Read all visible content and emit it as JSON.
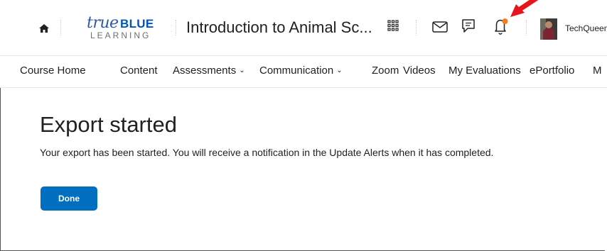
{
  "header": {
    "logo": {
      "script": "true",
      "brand": "BLUE",
      "sub": "LEARNING"
    },
    "course_title": "Introduction to Animal Sc...",
    "icons": [
      "home-icon",
      "apps-grid-icon",
      "mail-icon",
      "chat-icon",
      "bell-icon"
    ],
    "notification_dot_color": "#f57c1f",
    "user": {
      "name": "TechQueen"
    }
  },
  "nav": {
    "items": [
      {
        "label": "Course Home"
      },
      {
        "label": "Content"
      },
      {
        "label": "Assessments",
        "dropdown": true
      },
      {
        "label": "Communication",
        "dropdown": true
      },
      {
        "label": "Zoom"
      },
      {
        "label": "Videos"
      },
      {
        "label": "My Evaluations"
      },
      {
        "label": "ePortfolio"
      },
      {
        "label": "M"
      }
    ],
    "chevron": "⌄"
  },
  "main": {
    "title": "Export started",
    "message": "Your export has been started. You will receive a notification in the Update Alerts when it has completed.",
    "done_label": "Done"
  },
  "annotation": {
    "arrow_color": "#e8141b"
  },
  "colors": {
    "primary_button": "#006fbf",
    "logo_blue": "#0057b8"
  }
}
